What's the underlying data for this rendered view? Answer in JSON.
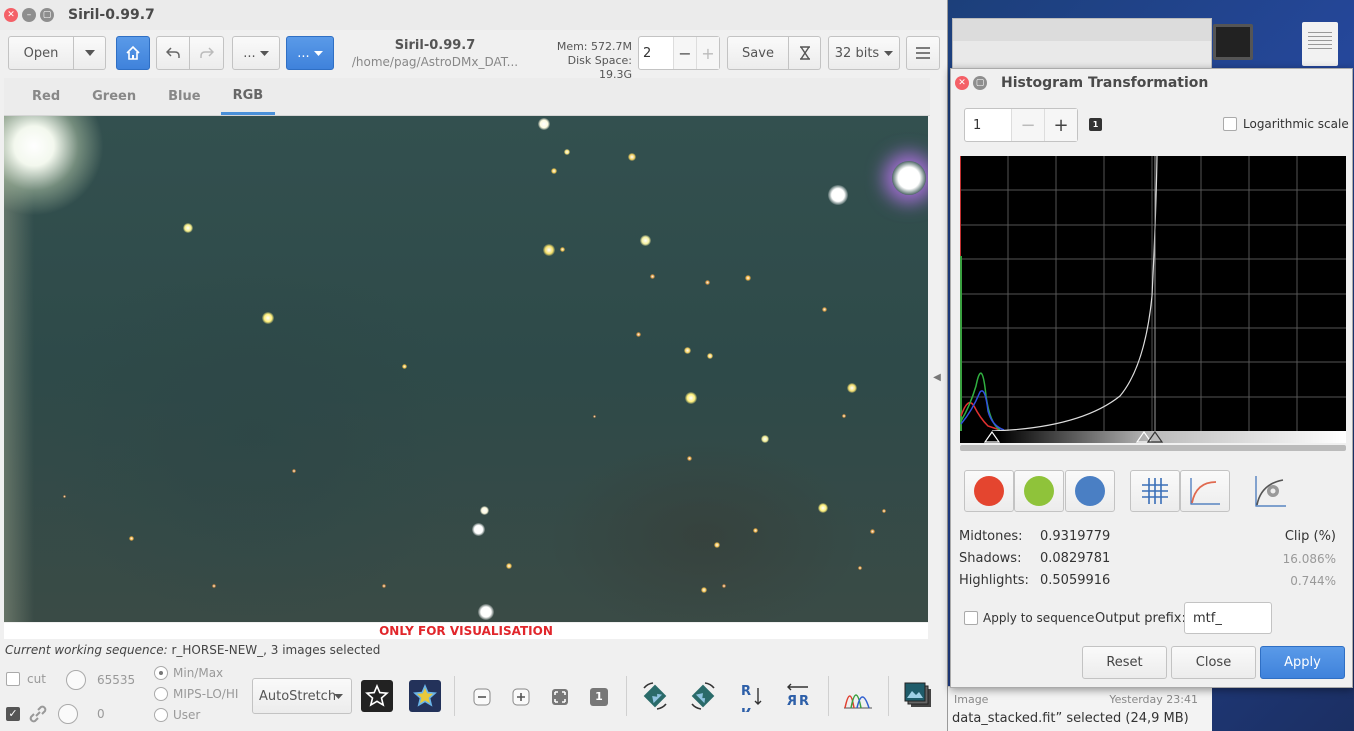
{
  "main_window": {
    "title": "Siril-0.99.7",
    "toolbar": {
      "open_label": "Open",
      "ellipsis1": "...",
      "ellipsis2": "...",
      "app_title": "Siril-0.99.7",
      "path": "/home/pag/AstroDMx_DAT...",
      "mem": "Mem: 572.7M",
      "disk": "Disk Space: 19.3G",
      "thread_count": "2",
      "save_label": "Save",
      "bits_label": "32 bits"
    },
    "tabs": [
      {
        "label": "Red"
      },
      {
        "label": "Green"
      },
      {
        "label": "Blue"
      },
      {
        "label": "RGB",
        "active": true
      }
    ],
    "visualisation_label": "ONLY FOR VISUALISATION",
    "sequence_prefix": "Current working sequence:",
    "sequence_value": " r_HORSE-NEW_, 3 images selected",
    "bottom": {
      "cut_label": "cut",
      "high_value": "65535",
      "low_value": "0",
      "radio_minmax": "Min/Max",
      "radio_mips": "MIPS-LO/HI",
      "radio_user": "User",
      "stretch_mode": "AutoStretch",
      "badge_one": "1"
    }
  },
  "histogram_dialog": {
    "title": "Histogram Transformation",
    "zoom_value": "1",
    "zoom_badge": "1",
    "log_scale_label": "Logarithmic scale",
    "midtones_label": "Midtones:",
    "midtones_value": "0.9319779",
    "shadows_label": "Shadows:",
    "shadows_value": "0.0829781",
    "highlights_label": "Highlights:",
    "highlights_value": "0.5059916",
    "clip_header": "Clip (%)",
    "shadows_clip": "16.086%",
    "highlights_clip": "0.744%",
    "apply_sequence_label": "Apply to sequence",
    "output_prefix_label": "Output prefix:",
    "output_prefix_value": "mtf_",
    "reset_label": "Reset",
    "close_label": "Close",
    "apply_label": "Apply",
    "channel_colors": {
      "red": "#e4452f",
      "green": "#8fc33a",
      "blue": "#4a7fc4"
    }
  },
  "background_window": {
    "row_left": "Image",
    "row_right": "Yesterday 23:41",
    "status": "data_stacked.fit” selected  (24,9 MB)"
  },
  "colors": {
    "accent": "#4a90d9",
    "warning_text": "#e1262b"
  }
}
